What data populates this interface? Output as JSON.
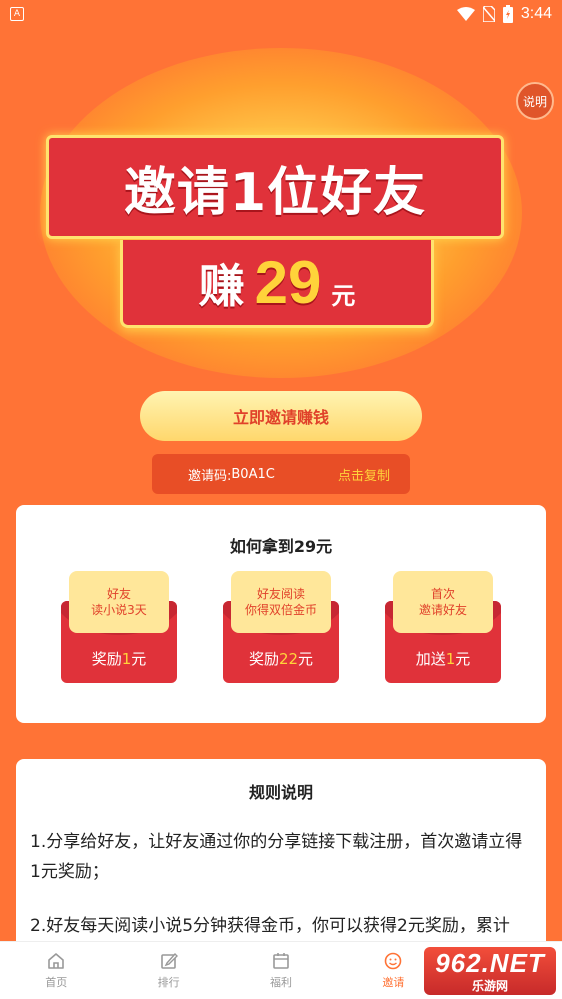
{
  "status_bar": {
    "time": "3:44",
    "app_glyph": "A"
  },
  "hero": {
    "help_label": "说明",
    "banner_title": "邀请1位好友",
    "earn_verb": "赚",
    "earn_amount": "29",
    "earn_unit": "元"
  },
  "invite_button_label": "立即邀请赚钱",
  "invite_code": {
    "label": "邀请码:",
    "value": "B0A1C",
    "copy_label": "点击复制"
  },
  "how_card": {
    "title": "如何拿到29元",
    "envelopes": [
      {
        "flap_text": "好友\n读小说3天",
        "reward_prefix": "奖励",
        "reward_amount": "1",
        "reward_unit": "元"
      },
      {
        "flap_text": "好友阅读\n你得双倍金币",
        "reward_prefix": "奖励",
        "reward_amount": "22",
        "reward_unit": "元"
      },
      {
        "flap_text": "首次\n邀请好友",
        "reward_prefix": "加送",
        "reward_amount": "1",
        "reward_unit": "元"
      }
    ]
  },
  "rules": {
    "title": "规则说明",
    "items": [
      "1.分享给好友，让好友通过你的分享链接下载注册，首次邀请立得1元奖励；",
      "2.好友每天阅读小说5分钟获得金币，你可以获得2元奖励，累计"
    ]
  },
  "bottom_nav": [
    {
      "label": "首页",
      "icon": "home-icon"
    },
    {
      "label": "排行",
      "icon": "edit-icon"
    },
    {
      "label": "福利",
      "icon": "calendar-icon"
    },
    {
      "label": "邀请",
      "icon": "smile-icon",
      "active": true
    }
  ],
  "watermark": {
    "main": "962.NET",
    "sub": "乐游网"
  },
  "colors": {
    "background": "#FF7336",
    "banner_red": "#E0323A",
    "gold": "#FFD33A",
    "nav_active": "#FF7336"
  }
}
